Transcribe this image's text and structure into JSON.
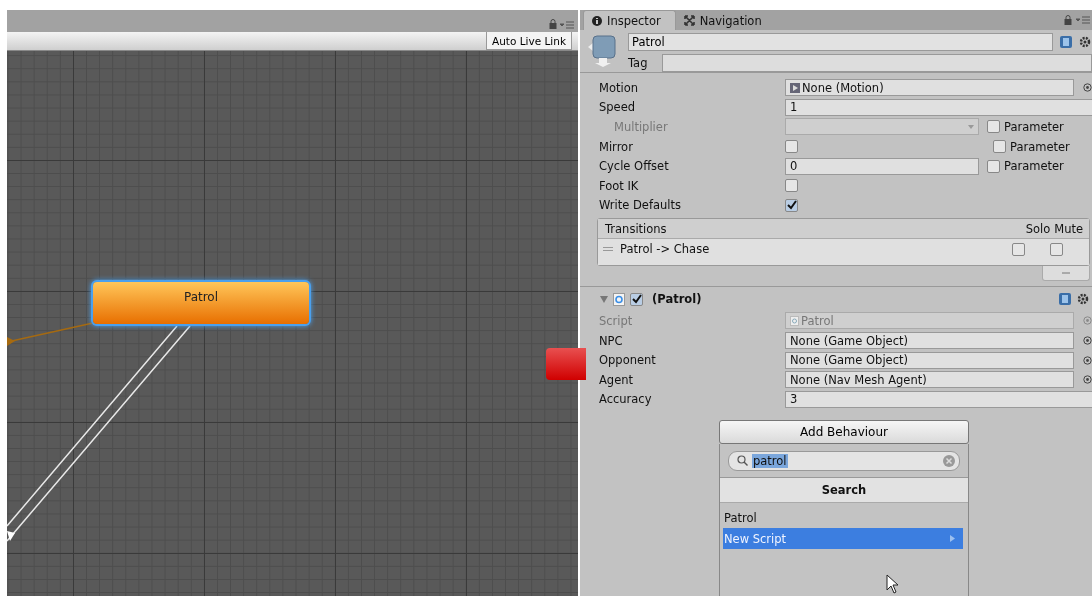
{
  "animator": {
    "auto_live_link": "Auto Live Link",
    "state_node": {
      "name": "Patrol",
      "selected": true
    }
  },
  "inspector": {
    "tabs": [
      {
        "label": "Inspector",
        "selected": true
      },
      {
        "label": "Navigation",
        "selected": false
      }
    ],
    "header": {
      "name": "Patrol",
      "tag_label": "Tag"
    },
    "properties": [
      {
        "kind": "object",
        "label": "Motion",
        "value": "None (Motion)"
      },
      {
        "kind": "number",
        "label": "Speed",
        "value": "1",
        "children": [
          {
            "kind": "dropdown",
            "label": "Multiplier",
            "disabled": true,
            "parameter": {
              "label": "Parameter",
              "checked": false
            }
          }
        ]
      },
      {
        "kind": "checkbox",
        "label": "Mirror",
        "checked": false,
        "parameter": {
          "label": "Parameter",
          "checked": false
        }
      },
      {
        "kind": "number",
        "label": "Cycle Offset",
        "value": "0",
        "parameter": {
          "label": "Parameter",
          "checked": false
        }
      },
      {
        "kind": "checkbox",
        "label": "Foot IK",
        "checked": false
      },
      {
        "kind": "checkbox",
        "label": "Write Defaults",
        "checked": true
      }
    ],
    "transitions": {
      "title": "Transitions",
      "solo_label": "Solo",
      "mute_label": "Mute",
      "rows": [
        {
          "name": "Patrol -> Chase",
          "solo": false,
          "mute": false
        }
      ]
    },
    "component": {
      "title": "(Patrol)",
      "enabled": true,
      "expanded": true,
      "fields": [
        {
          "kind": "script",
          "label": "Script",
          "value": "Patrol",
          "disabled": true
        },
        {
          "kind": "object",
          "label": "NPC",
          "value": "None (Game Object)"
        },
        {
          "kind": "object",
          "label": "Opponent",
          "value": "None (Game Object)"
        },
        {
          "kind": "object",
          "label": "Agent",
          "value": "None (Nav Mesh Agent)"
        },
        {
          "kind": "number",
          "label": "Accuracy",
          "value": "3"
        }
      ]
    },
    "add_behaviour": {
      "button": "Add Behaviour",
      "search_value": "patrol",
      "section": "Search",
      "items": [
        {
          "label": "Patrol",
          "selected": false,
          "submenu": false
        },
        {
          "label": "New Script",
          "selected": true,
          "submenu": true
        }
      ]
    }
  }
}
